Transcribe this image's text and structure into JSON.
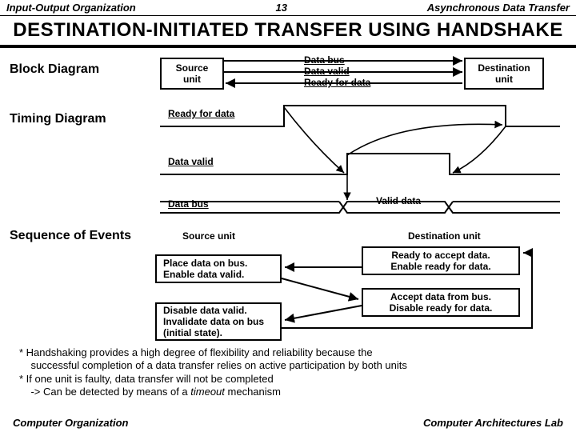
{
  "header": {
    "left": "Input-Output Organization",
    "center": "13",
    "right": "Asynchronous Data Transfer"
  },
  "title": "DESTINATION-INITIATED  TRANSFER  USING  HANDSHAKE",
  "sections": {
    "block": "Block Diagram",
    "timing": "Timing Diagram",
    "sequence": "Sequence of Events"
  },
  "block": {
    "source": "Source\nunit",
    "destination": "Destination\nunit",
    "signals": {
      "databus": "Data bus",
      "datavalid": "Data valid",
      "ready": "Ready for data"
    }
  },
  "timing": {
    "ready": "Ready for data",
    "datavalid": "Data valid",
    "databus": "Data bus",
    "validdata": "Valid data"
  },
  "sequence": {
    "sourceCol": "Source unit",
    "destCol": "Destination unit",
    "destA": "Ready to accept data.\nEnable ready for data.",
    "srcA": "Place data on bus.\nEnable data valid.",
    "destB": "Accept data from bus.\nDisable ready for data.",
    "srcB": "Disable data valid.\nInvalidate data on bus\n(initial state)."
  },
  "notes": {
    "n1a": "* Handshaking provides a high degree of flexibility and reliability because the",
    "n1b": "    successful completion of a data transfer relies on active participation by both units",
    "n2": "* If one unit is faulty, data transfer will not be completed",
    "n3a": "    -> Can be detected by means of a ",
    "n3b": "timeout",
    "n3c": "  mechanism"
  },
  "footer": {
    "left": "Computer Organization",
    "right": "Computer Architectures Lab"
  }
}
